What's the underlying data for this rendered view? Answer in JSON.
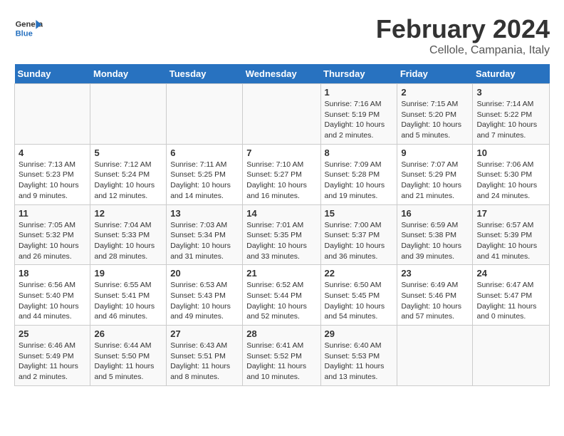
{
  "logo": {
    "text_general": "General",
    "text_blue": "Blue"
  },
  "header": {
    "title": "February 2024",
    "subtitle": "Cellole, Campania, Italy"
  },
  "weekdays": [
    "Sunday",
    "Monday",
    "Tuesday",
    "Wednesday",
    "Thursday",
    "Friday",
    "Saturday"
  ],
  "weeks": [
    [
      {
        "day": "",
        "detail": ""
      },
      {
        "day": "",
        "detail": ""
      },
      {
        "day": "",
        "detail": ""
      },
      {
        "day": "",
        "detail": ""
      },
      {
        "day": "1",
        "detail": "Sunrise: 7:16 AM\nSunset: 5:19 PM\nDaylight: 10 hours\nand 2 minutes."
      },
      {
        "day": "2",
        "detail": "Sunrise: 7:15 AM\nSunset: 5:20 PM\nDaylight: 10 hours\nand 5 minutes."
      },
      {
        "day": "3",
        "detail": "Sunrise: 7:14 AM\nSunset: 5:22 PM\nDaylight: 10 hours\nand 7 minutes."
      }
    ],
    [
      {
        "day": "4",
        "detail": "Sunrise: 7:13 AM\nSunset: 5:23 PM\nDaylight: 10 hours\nand 9 minutes."
      },
      {
        "day": "5",
        "detail": "Sunrise: 7:12 AM\nSunset: 5:24 PM\nDaylight: 10 hours\nand 12 minutes."
      },
      {
        "day": "6",
        "detail": "Sunrise: 7:11 AM\nSunset: 5:25 PM\nDaylight: 10 hours\nand 14 minutes."
      },
      {
        "day": "7",
        "detail": "Sunrise: 7:10 AM\nSunset: 5:27 PM\nDaylight: 10 hours\nand 16 minutes."
      },
      {
        "day": "8",
        "detail": "Sunrise: 7:09 AM\nSunset: 5:28 PM\nDaylight: 10 hours\nand 19 minutes."
      },
      {
        "day": "9",
        "detail": "Sunrise: 7:07 AM\nSunset: 5:29 PM\nDaylight: 10 hours\nand 21 minutes."
      },
      {
        "day": "10",
        "detail": "Sunrise: 7:06 AM\nSunset: 5:30 PM\nDaylight: 10 hours\nand 24 minutes."
      }
    ],
    [
      {
        "day": "11",
        "detail": "Sunrise: 7:05 AM\nSunset: 5:32 PM\nDaylight: 10 hours\nand 26 minutes."
      },
      {
        "day": "12",
        "detail": "Sunrise: 7:04 AM\nSunset: 5:33 PM\nDaylight: 10 hours\nand 28 minutes."
      },
      {
        "day": "13",
        "detail": "Sunrise: 7:03 AM\nSunset: 5:34 PM\nDaylight: 10 hours\nand 31 minutes."
      },
      {
        "day": "14",
        "detail": "Sunrise: 7:01 AM\nSunset: 5:35 PM\nDaylight: 10 hours\nand 33 minutes."
      },
      {
        "day": "15",
        "detail": "Sunrise: 7:00 AM\nSunset: 5:37 PM\nDaylight: 10 hours\nand 36 minutes."
      },
      {
        "day": "16",
        "detail": "Sunrise: 6:59 AM\nSunset: 5:38 PM\nDaylight: 10 hours\nand 39 minutes."
      },
      {
        "day": "17",
        "detail": "Sunrise: 6:57 AM\nSunset: 5:39 PM\nDaylight: 10 hours\nand 41 minutes."
      }
    ],
    [
      {
        "day": "18",
        "detail": "Sunrise: 6:56 AM\nSunset: 5:40 PM\nDaylight: 10 hours\nand 44 minutes."
      },
      {
        "day": "19",
        "detail": "Sunrise: 6:55 AM\nSunset: 5:41 PM\nDaylight: 10 hours\nand 46 minutes."
      },
      {
        "day": "20",
        "detail": "Sunrise: 6:53 AM\nSunset: 5:43 PM\nDaylight: 10 hours\nand 49 minutes."
      },
      {
        "day": "21",
        "detail": "Sunrise: 6:52 AM\nSunset: 5:44 PM\nDaylight: 10 hours\nand 52 minutes."
      },
      {
        "day": "22",
        "detail": "Sunrise: 6:50 AM\nSunset: 5:45 PM\nDaylight: 10 hours\nand 54 minutes."
      },
      {
        "day": "23",
        "detail": "Sunrise: 6:49 AM\nSunset: 5:46 PM\nDaylight: 10 hours\nand 57 minutes."
      },
      {
        "day": "24",
        "detail": "Sunrise: 6:47 AM\nSunset: 5:47 PM\nDaylight: 11 hours\nand 0 minutes."
      }
    ],
    [
      {
        "day": "25",
        "detail": "Sunrise: 6:46 AM\nSunset: 5:49 PM\nDaylight: 11 hours\nand 2 minutes."
      },
      {
        "day": "26",
        "detail": "Sunrise: 6:44 AM\nSunset: 5:50 PM\nDaylight: 11 hours\nand 5 minutes."
      },
      {
        "day": "27",
        "detail": "Sunrise: 6:43 AM\nSunset: 5:51 PM\nDaylight: 11 hours\nand 8 minutes."
      },
      {
        "day": "28",
        "detail": "Sunrise: 6:41 AM\nSunset: 5:52 PM\nDaylight: 11 hours\nand 10 minutes."
      },
      {
        "day": "29",
        "detail": "Sunrise: 6:40 AM\nSunset: 5:53 PM\nDaylight: 11 hours\nand 13 minutes."
      },
      {
        "day": "",
        "detail": ""
      },
      {
        "day": "",
        "detail": ""
      }
    ]
  ]
}
